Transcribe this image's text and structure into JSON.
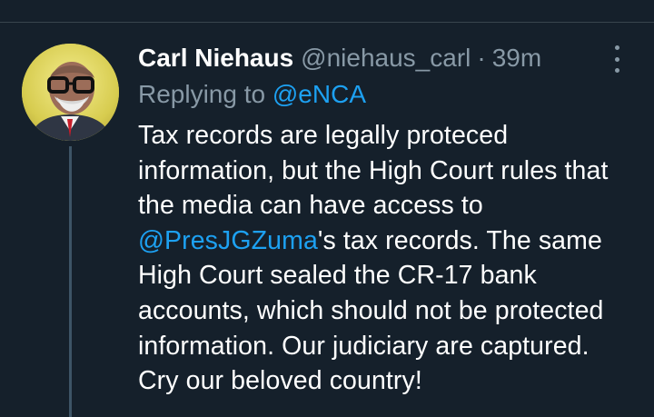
{
  "tweet": {
    "author_name": "Carl Niehaus",
    "author_handle": "@niehaus_carl",
    "separator": "·",
    "timestamp": "39m",
    "replying_prefix": "Replying to",
    "replying_to": "@eNCA",
    "text_lines": [
      {
        "text": "Tax records are legally proteced"
      },
      {
        "text": "information, but the High Court rules that"
      },
      {
        "text": "the media can have access to"
      },
      {
        "mention": "@PresJGZuma",
        "text": "'s tax records. The same"
      },
      {
        "text": "High Court sealed the CR-17 bank"
      },
      {
        "text": "accounts, which should not be protected"
      },
      {
        "text": "information. Our judiciary are captured."
      },
      {
        "text": "Cry our beloved country!"
      }
    ]
  },
  "icons": {
    "avatar": "profile-photo",
    "more": "more-options-vertical-icon"
  },
  "colors": {
    "background": "#15202b",
    "text": "#ffffff",
    "muted": "#8899a6",
    "link": "#1da1f2",
    "divider": "#38444d"
  }
}
